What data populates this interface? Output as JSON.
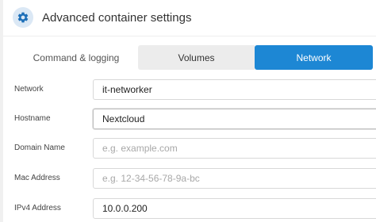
{
  "header": {
    "title": "Advanced container settings",
    "icon": "gear-icon",
    "icon_color": "#1d6fb8",
    "badge_color": "#dbe8f5"
  },
  "tabs": [
    {
      "label": "Command & logging",
      "selected": false
    },
    {
      "label": "Volumes",
      "selected": false
    },
    {
      "label": "Network",
      "selected": true
    }
  ],
  "accent_color": "#1d87d4",
  "form": {
    "network": {
      "label": "Network",
      "value": "it-networker",
      "placeholder": ""
    },
    "hostname": {
      "label": "Hostname",
      "value": "Nextcloud",
      "placeholder": ""
    },
    "domain_name": {
      "label": "Domain Name",
      "value": "",
      "placeholder": "e.g. example.com"
    },
    "mac_address": {
      "label": "Mac Address",
      "value": "",
      "placeholder": "e.g. 12-34-56-78-9a-bc"
    },
    "ipv4_address": {
      "label": "IPv4 Address",
      "value": "10.0.0.200",
      "placeholder": ""
    }
  }
}
